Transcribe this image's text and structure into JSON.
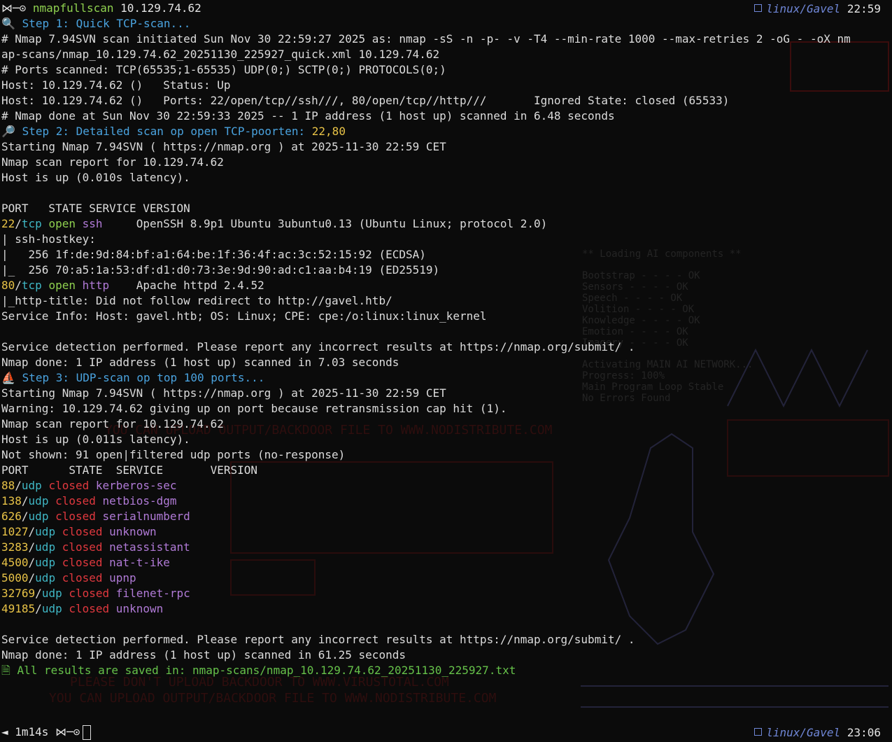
{
  "prompt": {
    "symbol": "⋈─⊙",
    "command": "nmapfullscan",
    "target": "10.129.74.62",
    "end_prompt_prefix": "◄ 1m14s",
    "end_symbol": "⋈─⊙"
  },
  "status_top": {
    "path": "linux/Gavel",
    "time": "22:59"
  },
  "status_bottom": {
    "path": "linux/Gavel",
    "time": "23:06"
  },
  "step1": {
    "icon": "🔍",
    "text": "Step 1: Quick TCP-scan..."
  },
  "quick": {
    "l1": "# Nmap 7.94SVN scan initiated Sun Nov 30 22:59:27 2025 as: nmap -sS -n -p- -v -T4 --min-rate 1000 --max-retries 2 -oG - -oX nm",
    "l2": "ap-scans/nmap_10.129.74.62_20251130_225927_quick.xml 10.129.74.62",
    "l3": "# Ports scanned: TCP(65535;1-65535) UDP(0;) SCTP(0;) PROTOCOLS(0;)",
    "l4": "Host: 10.129.74.62 ()   Status: Up",
    "l5": "Host: 10.129.74.62 ()   Ports: 22/open/tcp//ssh///, 80/open/tcp//http///       Ignored State: closed (65533)",
    "l6": "# Nmap done at Sun Nov 30 22:59:33 2025 -- 1 IP address (1 host up) scanned in 6.48 seconds"
  },
  "step2": {
    "icon": "🔎",
    "text": "Step 2: Detailed scan op open TCP-poorten: ",
    "ports": "22,80"
  },
  "detailed": {
    "l1": "Starting Nmap 7.94SVN ( https://nmap.org ) at 2025-11-30 22:59 CET",
    "l2": "Nmap scan report for 10.129.74.62",
    "l3": "Host is up (0.010s latency).",
    "header": "PORT   STATE SERVICE VERSION",
    "ssh": {
      "port": "22",
      "proto": "tcp",
      "state": "open",
      "service": "ssh",
      "version": "     OpenSSH 8.9p1 Ubuntu 3ubuntu0.13 (Ubuntu Linux; protocol 2.0)"
    },
    "hk1": "| ssh-hostkey: ",
    "hk2": "|   256 1f:de:9d:84:bf:a1:64:be:1f:36:4f:ac:3c:52:15:92 (ECDSA)",
    "hk3": "|_  256 70:a5:1a:53:df:d1:d0:73:3e:9d:90:ad:c1:aa:b4:19 (ED25519)",
    "http": {
      "port": "80",
      "proto": "tcp",
      "state": "open",
      "service": "http",
      "version": "    Apache httpd 2.4.52"
    },
    "title": "|_http-title: Did not follow redirect to http://gavel.htb/",
    "svcinfo": "Service Info: Host: gavel.htb; OS: Linux; CPE: cpe:/o:linux:linux_kernel",
    "svcdet": "Service detection performed. Please report any incorrect results at https://nmap.org/submit/ .",
    "done": "Nmap done: 1 IP address (1 host up) scanned in 7.03 seconds"
  },
  "step3": {
    "icon": "⛵",
    "text": "Step 3: UDP-scan op top 100 ports..."
  },
  "udp": {
    "l1": "Starting Nmap 7.94SVN ( https://nmap.org ) at 2025-11-30 22:59 CET",
    "l2": "Warning: 10.129.74.62 giving up on port because retransmission cap hit (1).",
    "l3": "Nmap scan report for 10.129.74.62",
    "l4": "Host is up (0.011s latency).",
    "l5": "Not shown: 91 open|filtered udp ports (no-response)",
    "header": "PORT      STATE  SERVICE       VERSION",
    "rows": [
      {
        "port": "88",
        "proto": "udp",
        "state": "closed",
        "service": "kerberos-sec"
      },
      {
        "port": "138",
        "proto": "udp",
        "state": "closed",
        "service": "netbios-dgm"
      },
      {
        "port": "626",
        "proto": "udp",
        "state": "closed",
        "service": "serialnumberd"
      },
      {
        "port": "1027",
        "proto": "udp",
        "state": "closed",
        "service": "unknown"
      },
      {
        "port": "3283",
        "proto": "udp",
        "state": "closed",
        "service": "netassistant"
      },
      {
        "port": "4500",
        "proto": "udp",
        "state": "closed",
        "service": "nat-t-ike"
      },
      {
        "port": "5000",
        "proto": "udp",
        "state": "closed",
        "service": "upnp"
      },
      {
        "port": "32769",
        "proto": "udp",
        "state": "closed",
        "service": "filenet-rpc"
      },
      {
        "port": "49185",
        "proto": "udp",
        "state": "closed",
        "service": "unknown"
      }
    ],
    "svcdet": "Service detection performed. Please report any incorrect results at https://nmap.org/submit/ .",
    "done": "Nmap done: 1 IP address (1 host up) scanned in 61.25 seconds"
  },
  "saved": {
    "icon": "🗎",
    "text": "All results are saved in: nmap-scans/nmap_10.129.74.62_20251130_225927.txt"
  },
  "wallpaper": {
    "backdoor1": "YOU CAN UPLOAD OUTPUT/BACKDOOR FILE TO WWW.NODISTRIBUTE.COM",
    "backdoor2": "PLEASE DON'T UPLOAD BACKDOOR TO WWW.VIRUSTOTAL.COM",
    "backdoor3": "YOU CAN UPLOAD OUTPUT/BACKDOOR FILE TO WWW.NODISTRIBUTE.COM",
    "loading": "** Loading AI components **",
    "comps": [
      "Bootstrap  - - - -  OK",
      "Sensors  - - - -  OK",
      "Speech  - - - -  OK",
      "Volition  - - - -  OK",
      "Knowledge  - - - -  OK",
      "Emotion  - - - -  OK",
      "Imagery  - - - -  OK"
    ],
    "net1": "Activating MAIN AI NETWORK...",
    "net2": "Progress: 100%",
    "net3": "Main Program Loop Stable",
    "net4": "No Errors Found"
  },
  "colors": {
    "background": "#0b0b0b",
    "text": "#e4e4e4",
    "green": "#8fd14f",
    "step_blue": "#4aa3df",
    "yellow": "#e8c347",
    "cyan": "#3fb6c4",
    "red": "#e0383e",
    "purple": "#b07ad6"
  }
}
